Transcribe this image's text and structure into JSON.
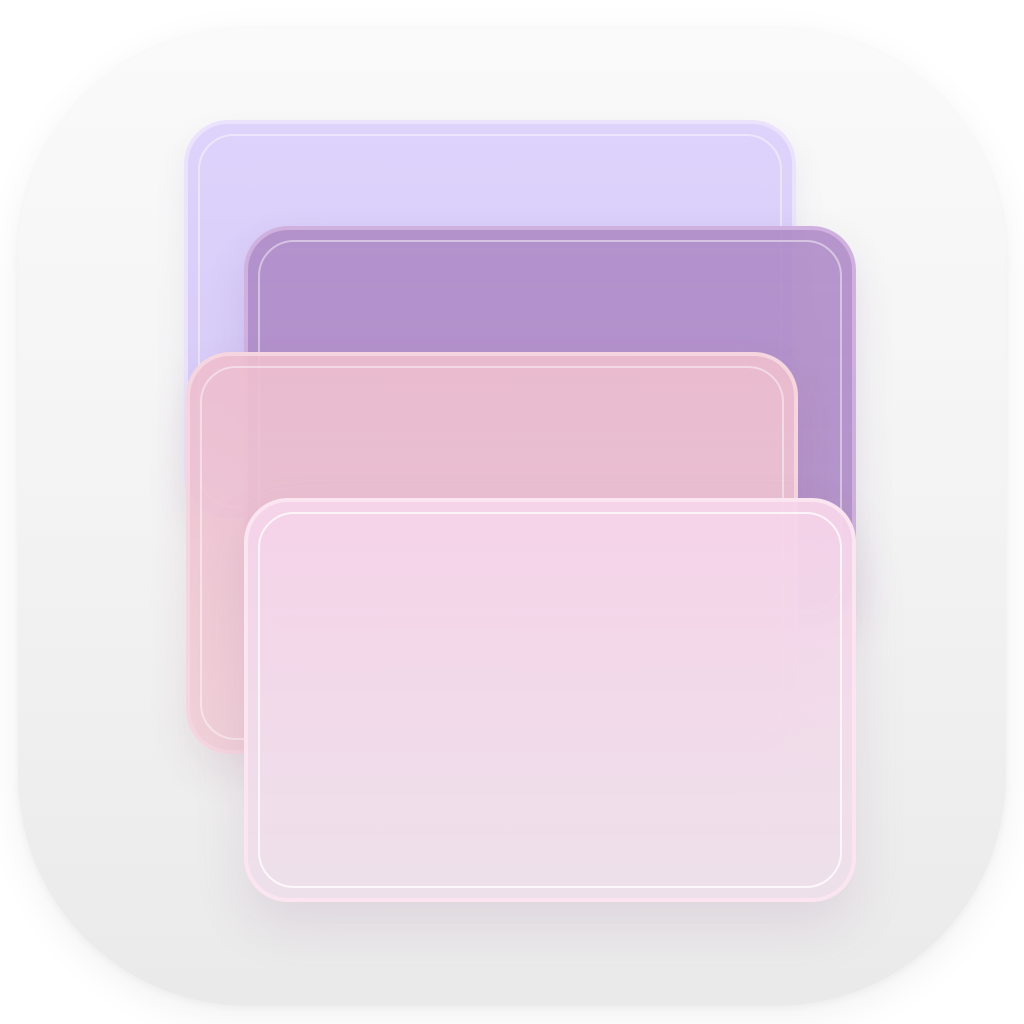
{
  "app_icon": {
    "semantic": "stacked-windows-icon",
    "colors": {
      "background_top": "#fafafa",
      "background_bottom": "#eaeaea",
      "card_lavender": "#d9cdf8",
      "card_purple": "#b08dc6",
      "card_rose": "#eebfd0",
      "card_pink": "#f3d6e8"
    },
    "layers": [
      {
        "name": "lavender-card-icon"
      },
      {
        "name": "purple-card-icon"
      },
      {
        "name": "rose-card-icon"
      },
      {
        "name": "pink-card-icon"
      }
    ]
  }
}
